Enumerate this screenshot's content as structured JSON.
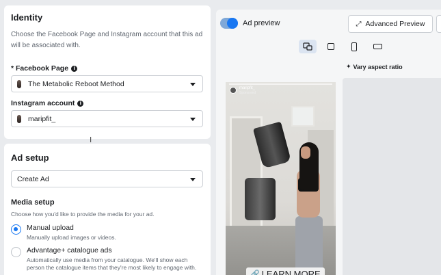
{
  "identity": {
    "title": "Identity",
    "description": "Choose the Facebook Page and Instagram account that this ad will be associated with.",
    "facebook_page_label": "* Facebook Page",
    "facebook_page_value": "The Metabolic Reboot Method",
    "instagram_label": "Instagram account",
    "instagram_value": "maripfit_"
  },
  "ad_setup": {
    "title": "Ad setup",
    "select_value": "Create Ad",
    "media_setup_title": "Media setup",
    "media_setup_desc": "Choose how you'd like to provide the media for your ad.",
    "options": [
      {
        "title": "Manual upload",
        "subtitle": "Manually upload images or videos.",
        "selected": true
      },
      {
        "title": "Advantage+ catalogue ads",
        "subtitle": "Automatically use media from your catalogue. We'll show each person the catalogue items that they're most likely to engage with.",
        "selected": false
      }
    ]
  },
  "preview": {
    "toggle_label": "Ad preview",
    "toggle_on": true,
    "advanced_button": "Advanced Preview",
    "vary_label": "Vary aspect ratio",
    "story": {
      "handle": "maripfit_",
      "sub": "Sponsored",
      "cta": "LEARN MORE"
    }
  },
  "colors": {
    "accent": "#1877f2",
    "background": "#e9ebee"
  },
  "icons": {
    "info": "info-icon",
    "caret": "chevron-down-icon",
    "expand": "expand-icon",
    "sparkle": "sparkle-icon",
    "link": "link-icon"
  }
}
